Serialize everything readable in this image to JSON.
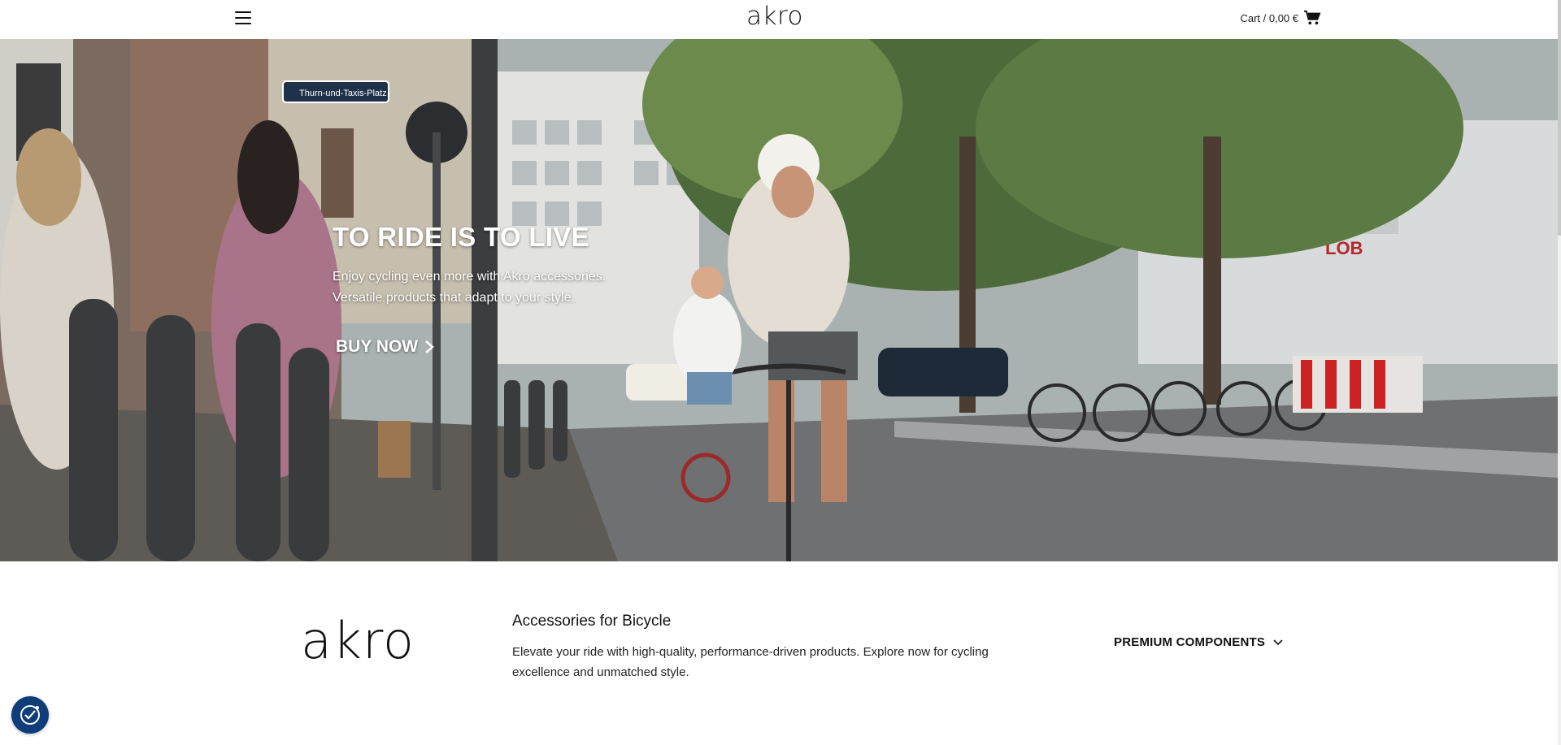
{
  "header": {
    "logo_text": "akro",
    "cart_label": "Cart / 0,00 €",
    "menu_icon": "hamburger-menu-icon",
    "cart_icon": "shopping-cart-icon"
  },
  "hero": {
    "title": "TO RIDE IS TO LIVE",
    "subtitle_line1": "Enjoy cycling even more with Akro accessories.",
    "subtitle_line2": "Versatile products that adapt to your style.",
    "cta_label": "BUY NOW",
    "cta_icon": "chevron-right-icon",
    "street_sign": "Thurn-und-Taxis-Platz"
  },
  "intro": {
    "logo_text": "akro",
    "title": "Accessories for Bicycle",
    "description": "Elevate your ride with high-quality, performance-driven products. Explore now for cycling excellence and unmatched style.",
    "dropdown_label": "PREMIUM COMPONENTS",
    "dropdown_icon": "chevron-down-icon"
  },
  "widgets": {
    "cookie_icon": "cookie-consent-icon"
  },
  "colors": {
    "text": "#111111",
    "cookie_button": "#0f3d7a"
  }
}
